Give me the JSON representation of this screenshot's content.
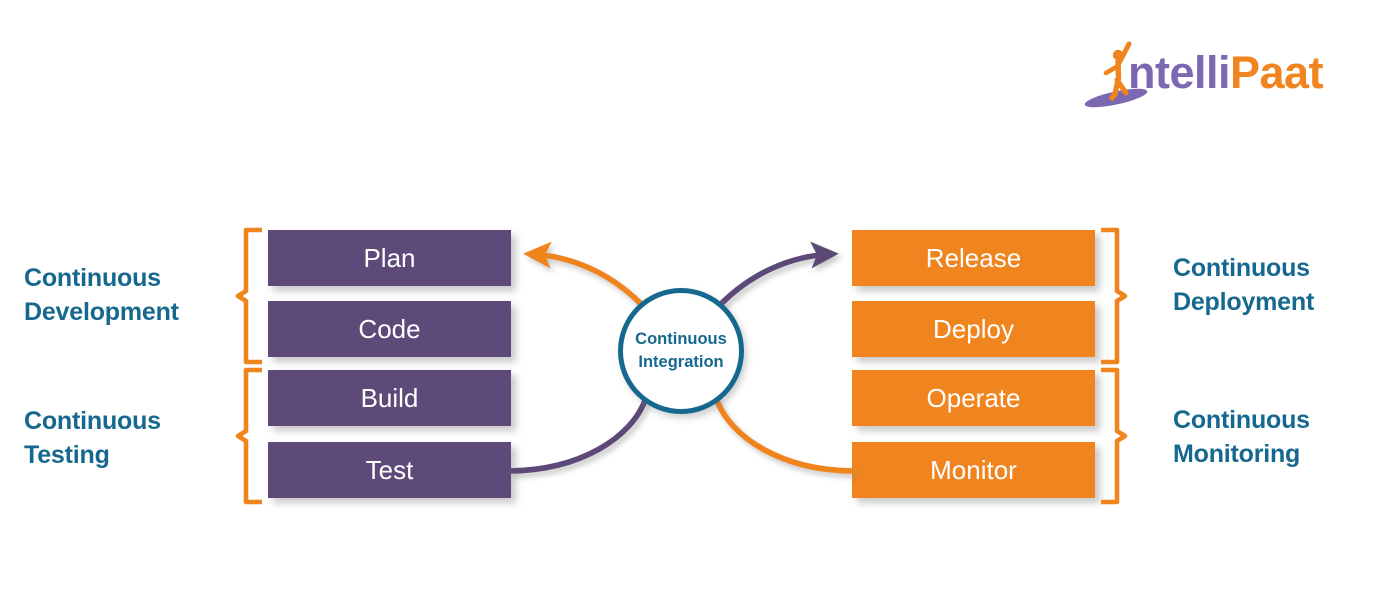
{
  "logo": {
    "name": "intellipaat-logo",
    "text_part_1": "ntelli",
    "text_part_2": "Paat",
    "figure_icon": "person-on-surfboard-icon",
    "colors": {
      "purple": "#7B68B0",
      "orange": "#F0841E"
    }
  },
  "diagram": {
    "type": "devops-lifecycle",
    "center": {
      "line1": "Continuous",
      "line2": "Integration",
      "border_color": "#16688F",
      "text_color": "#16688F"
    },
    "left_column": {
      "box_color": "#5D4A78",
      "text_color": "#FFFFFF",
      "boxes": [
        {
          "label": "Plan"
        },
        {
          "label": "Code"
        },
        {
          "label": "Build"
        },
        {
          "label": "Test"
        }
      ]
    },
    "right_column": {
      "box_color": "#F0841E",
      "text_color": "#FFFFFF",
      "boxes": [
        {
          "label": "Release"
        },
        {
          "label": "Deploy"
        },
        {
          "label": "Operate"
        },
        {
          "label": "Monitor"
        }
      ]
    },
    "group_labels": {
      "color": "#16688F",
      "left_top": {
        "line1": "Continuous",
        "line2": "Development"
      },
      "left_bottom": {
        "line1": "Continuous",
        "line2": "Testing"
      },
      "right_top": {
        "line1": "Continuous",
        "line2": "Deployment"
      },
      "right_bottom": {
        "line1": "Continuous",
        "line2": "Monitoring"
      }
    },
    "brackets": {
      "color": "#F0841E",
      "count": 4,
      "items": [
        {
          "name": "bracket-continuous-development",
          "groups": [
            "Plan",
            "Code"
          ]
        },
        {
          "name": "bracket-continuous-testing",
          "groups": [
            "Build",
            "Test"
          ]
        },
        {
          "name": "bracket-continuous-deployment",
          "groups": [
            "Release",
            "Deploy"
          ]
        },
        {
          "name": "bracket-continuous-monitoring",
          "groups": [
            "Operate",
            "Monitor"
          ]
        }
      ]
    },
    "connectors": [
      {
        "name": "arrow-integration-to-plan",
        "from": "Continuous Integration",
        "to": "Plan",
        "color": "#F0841E",
        "arrowhead": true
      },
      {
        "name": "arrow-integration-to-release",
        "from": "Continuous Integration",
        "to": "Release",
        "color": "#5D4A78",
        "arrowhead": true
      },
      {
        "name": "line-test-to-integration",
        "from": "Test",
        "to": "Continuous Integration",
        "color": "#5D4A78",
        "arrowhead": false
      },
      {
        "name": "line-integration-to-monitor",
        "from": "Continuous Integration",
        "to": "Monitor",
        "color": "#F0841E",
        "arrowhead": false
      }
    ]
  }
}
